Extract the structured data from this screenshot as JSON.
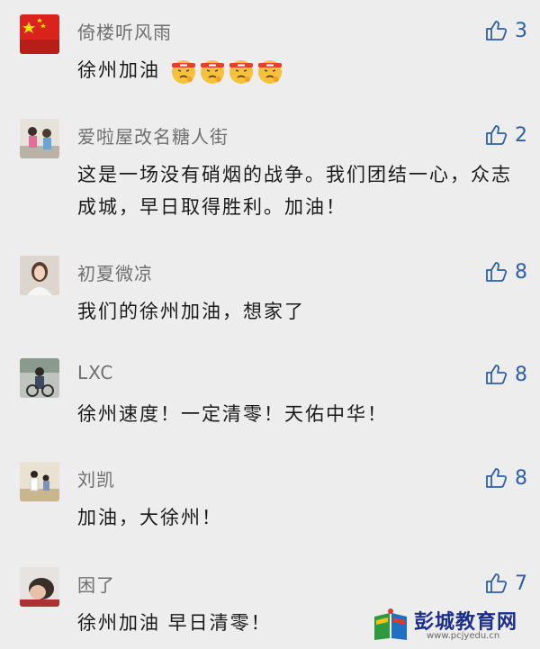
{
  "comments": [
    {
      "name": "倚楼听风雨",
      "text": "徐州加油",
      "likes": "3",
      "emoji": "face-with-headband",
      "emoji_count": 4
    },
    {
      "name": "爱啦屋改名糖人街",
      "text": "这是一场没有硝烟的战争。我们团结一心，众志成城，早日取得胜利。加油！",
      "likes": "2"
    },
    {
      "name": "初夏微凉",
      "text": "我们的徐州加油，想家了",
      "likes": "8"
    },
    {
      "name": "LXC",
      "text": "徐州速度！一定清零！天佑中华！",
      "likes": "8"
    },
    {
      "name": "刘凯",
      "text": "加油，大徐州！",
      "likes": "8"
    },
    {
      "name": "困了",
      "text": "徐州加油 早日清零！",
      "likes": "7"
    }
  ],
  "watermark": {
    "title": "彭城教育网",
    "url": "www.pcjyedu.cn"
  },
  "colors": {
    "background": "#ededed",
    "like_blue": "#2d5fa6",
    "name_gray": "#6f6f6f",
    "brand_blue": "#1d2e8a"
  }
}
